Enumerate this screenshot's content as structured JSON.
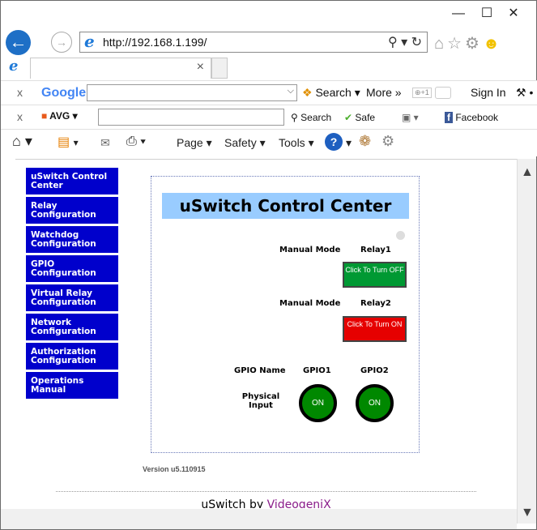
{
  "browser": {
    "url": "http://192.168.1.199/",
    "window_controls": {
      "minimize": "—",
      "maximize": "☐",
      "close": "✕"
    },
    "tab_close": "×"
  },
  "google_bar": {
    "close": "x",
    "logo": "Google",
    "search_label": "Search",
    "more_label": "More »",
    "signin_label": "Sign In"
  },
  "avg_bar": {
    "close": "x",
    "logo": "AVG",
    "search_label": "Search",
    "safe_label": "Safe",
    "facebook_label": "Facebook"
  },
  "command_bar": {
    "page_label": "Page",
    "safety_label": "Safety",
    "tools_label": "Tools"
  },
  "nav": [
    {
      "label": "uSwitch Control Center"
    },
    {
      "label": "Relay Configuration"
    },
    {
      "label": "Watchdog Configuration"
    },
    {
      "label": "GPIO Configuration"
    },
    {
      "label": "Virtual Relay Configuration"
    },
    {
      "label": "Network Configuration"
    },
    {
      "label": "Authorization Configuration"
    },
    {
      "label": "Operations Manual"
    }
  ],
  "panel": {
    "title": "uSwitch Control Center",
    "relays": [
      {
        "mode": "Manual Mode",
        "name": "Relay1",
        "button": "Click To Turn OFF",
        "color": "#009933"
      },
      {
        "mode": "Manual Mode",
        "name": "Relay2",
        "button": "Click To Turn ON",
        "color": "#e60000"
      }
    ],
    "gpio_name_label": "GPIO Name",
    "gpio_row_label": "Physical Input",
    "gpio": [
      {
        "name": "GPIO1",
        "state": "ON"
      },
      {
        "name": "GPIO2",
        "state": "ON"
      }
    ]
  },
  "version": "Version u5.110915",
  "footer": {
    "prefix": "uSwitch by ",
    "brand": "VideogeniX"
  }
}
